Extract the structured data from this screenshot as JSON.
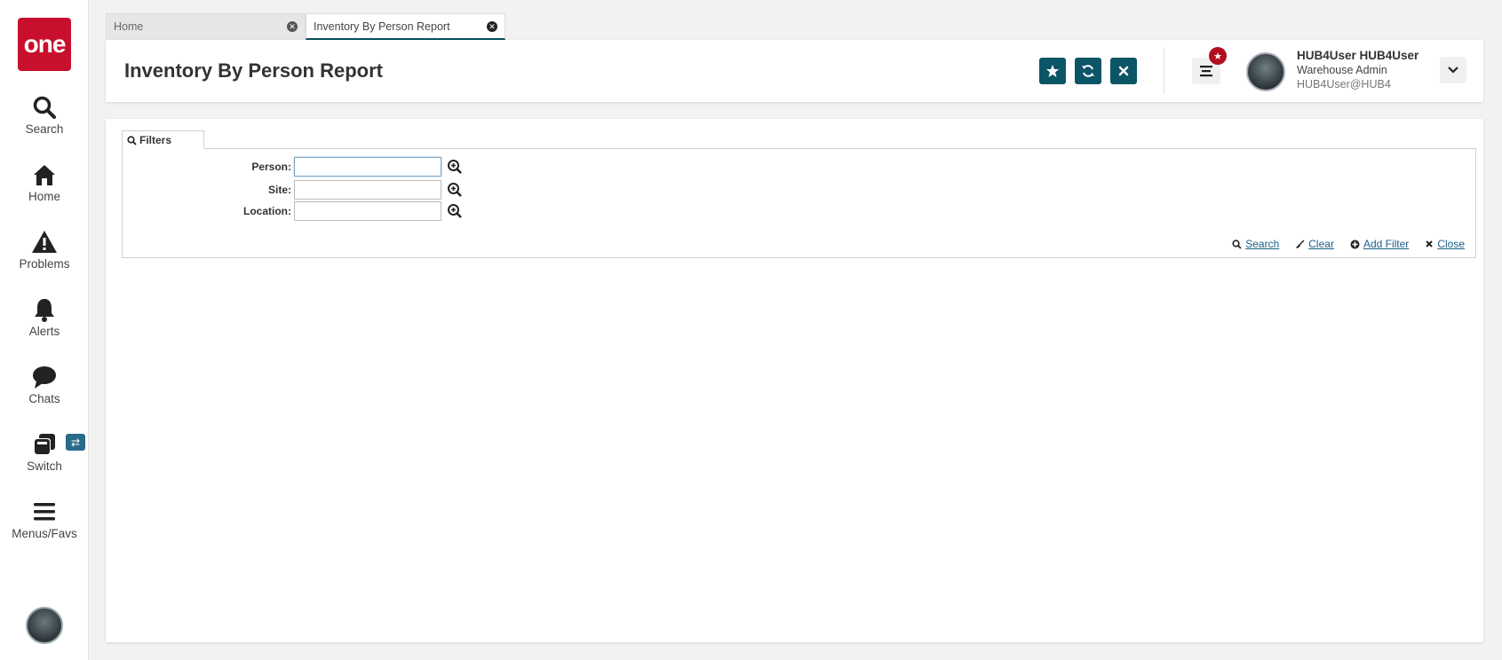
{
  "app": {
    "logo_text": "one",
    "brand_color": "#c8102e",
    "accent_color": "#0b5566"
  },
  "nav": {
    "items": [
      {
        "label": "Search",
        "icon": "search-icon"
      },
      {
        "label": "Home",
        "icon": "home-icon"
      },
      {
        "label": "Problems",
        "icon": "warning-icon"
      },
      {
        "label": "Alerts",
        "icon": "bell-icon"
      },
      {
        "label": "Chats",
        "icon": "chat-icon"
      },
      {
        "label": "Switch",
        "icon": "switch-icon"
      },
      {
        "label": "Menus/Favs",
        "icon": "hamburger-icon"
      }
    ]
  },
  "tabs": [
    {
      "label": "Home",
      "active": false
    },
    {
      "label": "Inventory By Person Report",
      "active": true
    }
  ],
  "header": {
    "title": "Inventory By Person Report",
    "actions": [
      "favorite-star-icon",
      "refresh-icon",
      "close-icon"
    ]
  },
  "user": {
    "name": "HUB4User HUB4User",
    "role": "Warehouse Admin",
    "email": "HUB4User@HUB4"
  },
  "filters": {
    "tab_label": "Filters",
    "fields": [
      {
        "label": "Person:",
        "value": ""
      },
      {
        "label": "Site:",
        "value": ""
      },
      {
        "label": "Location:",
        "value": ""
      }
    ],
    "actions": {
      "search": "Search",
      "clear": "Clear",
      "add_filter": "Add Filter",
      "close": "Close"
    }
  }
}
